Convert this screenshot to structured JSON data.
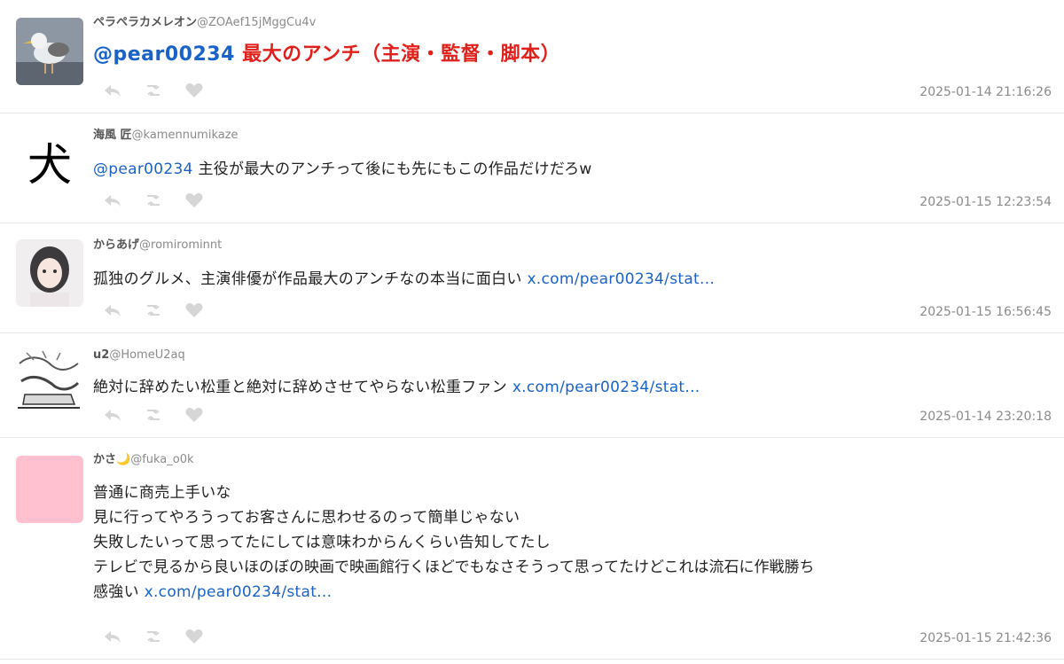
{
  "tweets": [
    {
      "name": "ペラペラカメレオン",
      "handle": "@ZOAef15jMggCu4v",
      "mention": "@pear00234",
      "text": " 最大のアンチ（主演・監督・脚本）",
      "timestamp": "2025-01-14 21:16:26"
    },
    {
      "name": "海風 匠",
      "handle": "@kamennumikaze",
      "mention": "@pear00234",
      "text": " 主役が最大のアンチって後にも先にもこの作品だけだろw",
      "timestamp": "2025-01-15 12:23:54",
      "avatar_char": "犬"
    },
    {
      "name": "からあげ",
      "handle": "@romirominnt",
      "text": "孤独のグルメ、主演俳優が作品最大のアンチなの本当に面白い ",
      "link": "x.com/pear00234/stat...",
      "timestamp": "2025-01-15 16:56:45"
    },
    {
      "name": "u2",
      "handle": "@HomeU2aq",
      "text": "絶対に辞めたい松重と絶対に辞めさせてやらない松重ファン ",
      "link": "x.com/pear00234/stat...",
      "timestamp": "2025-01-14 23:20:18"
    },
    {
      "name": "かさ🌙",
      "handle": "@fuka_o0k",
      "lines": [
        "普通に商売上手いな",
        "見に行ってやろうってお客さんに思わせるのって簡単じゃない",
        "失敗したいって思ってたにしては意味わからんくらい告知してたし",
        "テレビで見るから良いほのぼの映画で映画館行くほどでもなさそうって思ってたけどこれは流石に作戦勝ち",
        "感強い "
      ],
      "link": "x.com/pear00234/stat...",
      "timestamp": "2025-01-15 21:42:36"
    }
  ],
  "colors": {
    "link": "#1a62c7",
    "accent_red": "#e0211b",
    "icon_gray": "#d6d6d6",
    "pink_avatar": "#ffc0cf"
  },
  "icons": [
    "reply-icon",
    "retweet-icon",
    "like-icon"
  ]
}
